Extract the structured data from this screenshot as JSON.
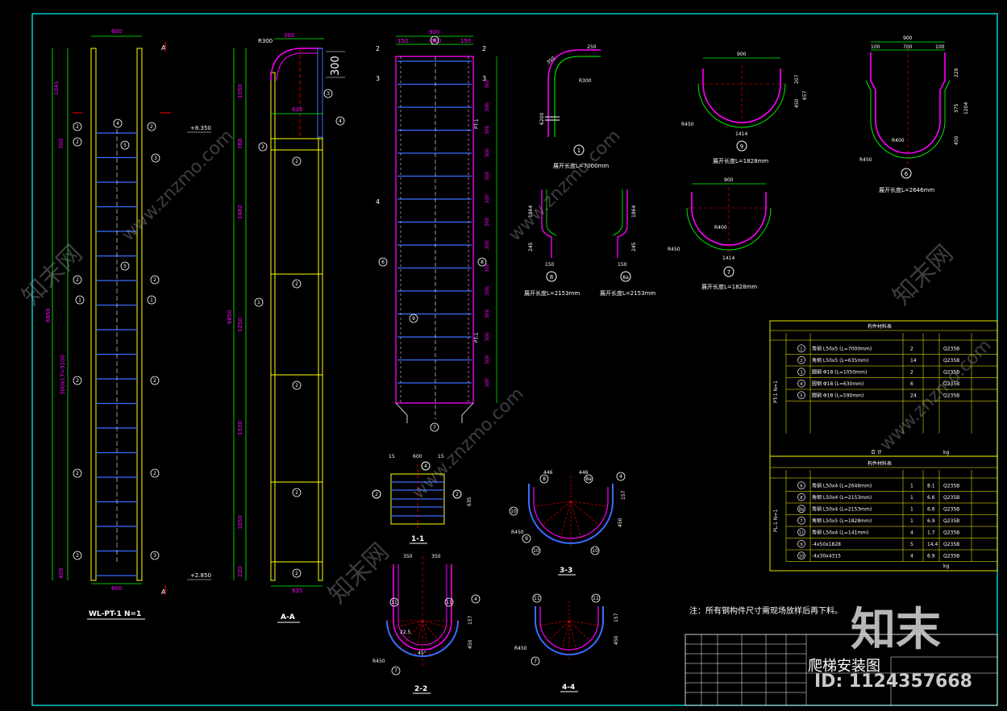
{
  "sheet": {
    "title": "爬梯安装图",
    "note": "注：所有钢构件尺寸需现场放样后再下料。",
    "watermark_brand": "知末",
    "watermark_id": "ID: 1124357668",
    "watermark_site": "www.znzmo.com",
    "watermark_cn": "知末网"
  },
  "views": {
    "main_label": "WL-PT-1  N=1",
    "aa_label": "A-A",
    "s11": "1-1",
    "s22": "2-2",
    "s33": "3-3",
    "s44": "4-4",
    "pt_top_dim": "600",
    "pt_bot_dim": "600",
    "elev_top": "+8.350",
    "elev_bot": "+2.850",
    "pt_total": "6850",
    "pt_seg1": "1041",
    "pt_seg2": "300",
    "pt_seg3": "300x17=5100",
    "pt_seg4": "409",
    "aa_r": "R300",
    "aa_w": "300",
    "aa_big": "300",
    "aa_635": "635",
    "aa_seg1": "1050",
    "aa_seg2": "368",
    "aa_seg3": "1482",
    "aa_total": "6850",
    "aa_seg4": "1250",
    "aa_seg5": "1330",
    "aa_seg6": "1050",
    "aa_seg7": "220",
    "aa_bot": "635",
    "front_top": "900",
    "front_150a": "150",
    "front_600": "600",
    "front_150b": "150",
    "front_pitch": "300",
    "front_pitch_label": "PT-1",
    "s11_15a": "15",
    "s11_600": "600",
    "s11_15b": "15",
    "s11_635": "635",
    "s22_350a": "350",
    "s22_350b": "350",
    "s22_r": "R450",
    "s22_157": "157",
    "s22_450": "450",
    "s22_ang": "22.5",
    "s22_45": "45°",
    "s33_446a": "446",
    "s33_446b": "446",
    "s33_r": "R450",
    "s33_157": "157",
    "s33_450": "450",
    "s44_r": "R450",
    "s44_157": "157",
    "s44_450": "450",
    "p1_250": "250",
    "p1_350": "350",
    "p1_r": "R300",
    "p1_6200": "6200",
    "p1_len": "展开长度L=7000mm",
    "p8_len": "展开长度L=2153mm",
    "p8a_len": "展开长度L=2153mm",
    "p8_1864": "1864",
    "p8_245": "245",
    "p8_150": "150",
    "p9_900": "900",
    "p9_r": "R450",
    "p9_1414": "1414",
    "p9_207": "207",
    "p9_450": "450",
    "p9_657": "657",
    "p9_len": "展开长度L=1828mm",
    "p7_900": "900",
    "p7_r450": "R450",
    "p7_r400": "R400",
    "p7_1414": "1414",
    "p7_len": "展开长度L=1828mm",
    "p6_900": "900",
    "p6_100a": "100",
    "p6_700": "700",
    "p6_100b": "100",
    "p6_229": "229",
    "p6_375": "375",
    "p6_1204": "1204",
    "p6_450": "450",
    "p6_r400": "R400",
    "p6_r450": "R450",
    "p6_len": "展开长度L=2646mm"
  },
  "table1": {
    "title": "构件材料表",
    "group": "PT-1  N=1",
    "rows": [
      {
        "no": "1",
        "spec": "角钢 L50x5",
        "len": "(L=7000mm)",
        "qty": "2",
        "mat": "Q235B"
      },
      {
        "no": "2",
        "spec": "角钢 L50x5",
        "len": "(L=635mm)",
        "qty": "14",
        "mat": "Q235B"
      },
      {
        "no": "3",
        "spec": "圆钢 Φ18",
        "len": "(L=1050mm)",
        "qty": "2",
        "mat": "Q235B"
      },
      {
        "no": "4",
        "spec": "圆钢 Φ18",
        "len": "(L=630mm)",
        "qty": "6",
        "mat": "Q235B"
      },
      {
        "no": "5",
        "spec": "圆钢 Φ18",
        "len": "(L=590mm)",
        "qty": "24",
        "mat": "Q235B"
      }
    ],
    "total_label": "合 计",
    "total_unit": "kg"
  },
  "table2": {
    "title": "构件材料表",
    "group": "PL-1  N=1",
    "rows": [
      {
        "no": "6",
        "spec": "角钢 L50x4",
        "len": "(L=2646mm)",
        "qty": "1",
        "w": "8.1",
        "mat": "Q235B"
      },
      {
        "no": "8",
        "spec": "角钢 L50x4",
        "len": "(L=2153mm)",
        "qty": "1",
        "w": "6.6",
        "mat": "Q235B"
      },
      {
        "no": "8a",
        "spec": "角钢 L50x4",
        "len": "(L=2153mm)",
        "qty": "1",
        "w": "6.6",
        "mat": "Q235B"
      },
      {
        "no": "7",
        "spec": "角钢 L50x5",
        "len": "(L=1828mm)",
        "qty": "1",
        "w": "6.9",
        "mat": "Q235B"
      },
      {
        "no": "11",
        "spec": "角钢 L50x4",
        "len": "(L=141mm)",
        "qty": "4",
        "w": "1.7",
        "mat": "Q235B"
      },
      {
        "no": "9",
        "spec": "-4x50x1828",
        "len": "",
        "qty": "5",
        "w": "14.4",
        "mat": "Q235B"
      },
      {
        "no": "10",
        "spec": "-4x30x4315",
        "len": "",
        "qty": "4",
        "w": "6.9",
        "mat": "Q235B"
      }
    ],
    "total_unit": "kg"
  },
  "colors": {
    "frame": "#00ffff",
    "yellow": "#ffff00",
    "blue": "#3a6cff",
    "magenta": "#ff00ff",
    "green": "#00ff00",
    "red": "#ff0000",
    "white": "#ffffff"
  }
}
